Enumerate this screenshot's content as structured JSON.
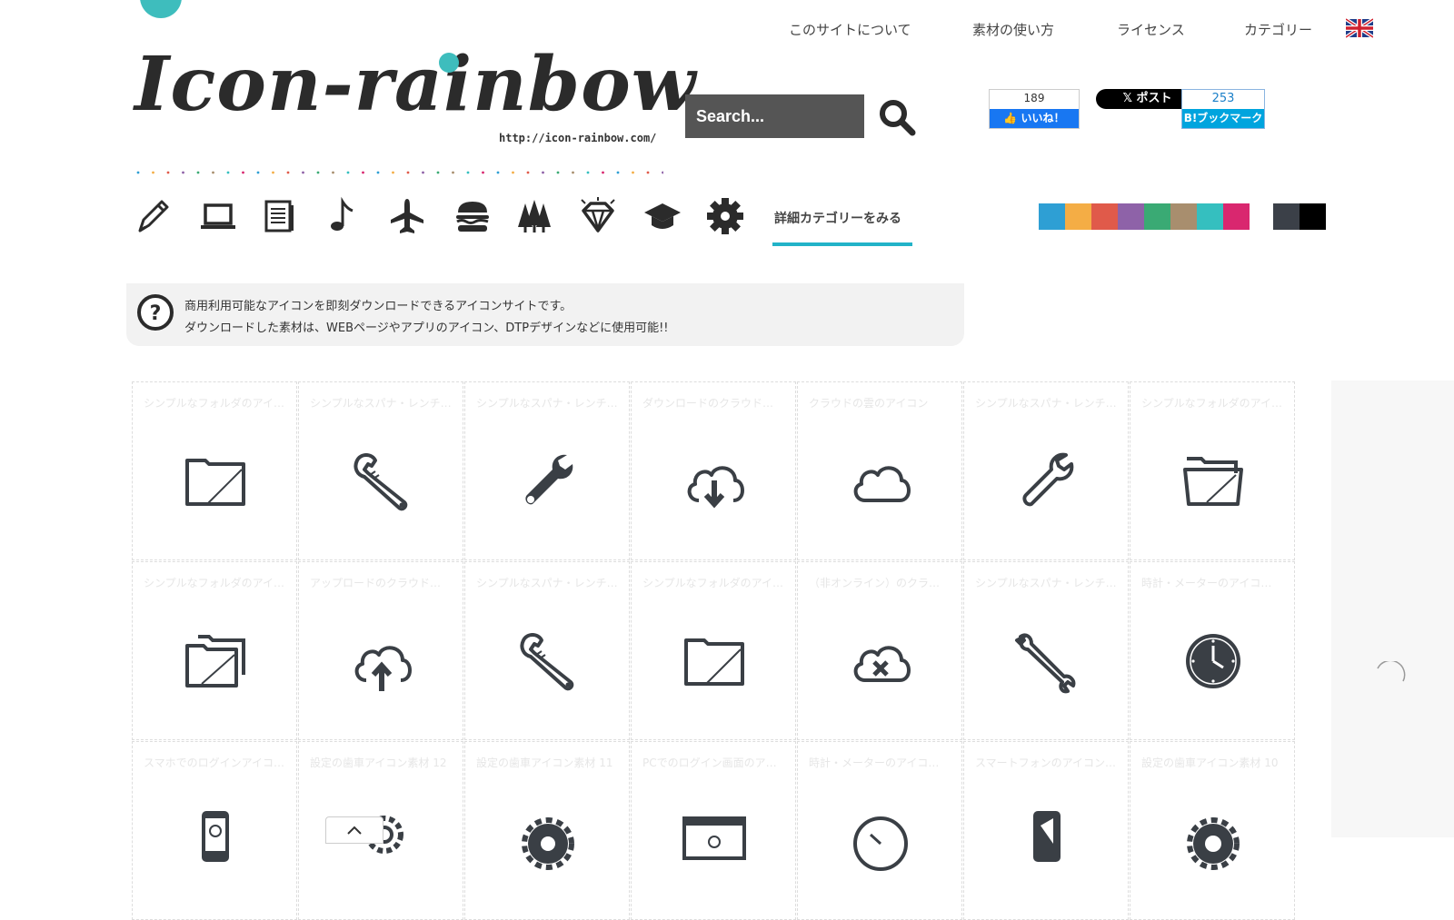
{
  "nav": {
    "items": [
      "このサイトについて",
      "素材の使い方",
      "ライセンス",
      "カテゴリー"
    ]
  },
  "logo": {
    "text": "Icon-rainbow",
    "url": "http://icon-rainbow.com/"
  },
  "search": {
    "placeholder": "Search..."
  },
  "social": {
    "fb_count": "189",
    "fb_label": "いいね！",
    "x_label": "ポスト",
    "hb_count": "253",
    "hb_label": "B!ブックマーク"
  },
  "categories": {
    "icons": [
      "pencil-icon",
      "laptop-icon",
      "document-icon",
      "music-note-icon",
      "airplane-icon",
      "burger-icon",
      "trees-icon",
      "diamond-icon",
      "graduation-cap-icon",
      "gear-icon"
    ],
    "more_label": "詳細カテゴリーをみる"
  },
  "colors": [
    "#2e9fd4",
    "#f4ad45",
    "#e05a4a",
    "#8e62a8",
    "#3aaa74",
    "#a88e6e",
    "#35bfbf",
    "#d9276f",
    "#3b4048",
    "#000000"
  ],
  "intro": {
    "line1": "商用利用可能なアイコンを即刻ダウンロードできるアイコンサイトです。",
    "line2": "ダウンロードした素材は、WEBページやアプリのアイコン、DTPデザインなどに使用可能!!"
  },
  "grid": [
    {
      "title": "シンプルなフォルダのアイ…",
      "icon": "folder-icon"
    },
    {
      "title": "シンプルなスパナ・レンチ…",
      "icon": "adjustable-wrench-icon"
    },
    {
      "title": "シンプルなスパナ・レンチ…",
      "icon": "wrench-solid-icon"
    },
    {
      "title": "ダウンロードのクラウド…",
      "icon": "cloud-download-icon"
    },
    {
      "title": "クラウドの雲のアイコン",
      "icon": "cloud-icon"
    },
    {
      "title": "シンプルなスパナ・レンチ…",
      "icon": "wrench-outline-icon"
    },
    {
      "title": "シンプルなフォルダのアイ…",
      "icon": "folder-open-icon"
    },
    {
      "title": "シンプルなフォルダのアイ…",
      "icon": "folders-icon"
    },
    {
      "title": "アップロードのクラウド…",
      "icon": "cloud-upload-icon"
    },
    {
      "title": "シンプルなスパナ・レンチ…",
      "icon": "adjustable-wrench-2-icon"
    },
    {
      "title": "シンプルなフォルダのアイ…",
      "icon": "folder-2-icon"
    },
    {
      "title": "（非オンライン）のクラ…",
      "icon": "cloud-x-icon"
    },
    {
      "title": "シンプルなスパナ・レンチ…",
      "icon": "double-wrench-icon"
    },
    {
      "title": "時計・メーターのアイコ…",
      "icon": "clock-icon"
    },
    {
      "title": "スマホでのログインアイコ…",
      "icon": "phone-login-icon"
    },
    {
      "title": "設定の歯車アイコン素材 12",
      "icon": "gears-icon"
    },
    {
      "title": "設定の歯車アイコン素材 11",
      "icon": "gear-lock-icon"
    },
    {
      "title": "PCでのログイン画面のア…",
      "icon": "pc-login-icon"
    },
    {
      "title": "時計・メーターのアイコ…",
      "icon": "meter-icon"
    },
    {
      "title": "スマートフォンのアイコン…",
      "icon": "smartphone-icon"
    },
    {
      "title": "設定の歯車アイコン素材 10",
      "icon": "gear-10-icon"
    }
  ]
}
